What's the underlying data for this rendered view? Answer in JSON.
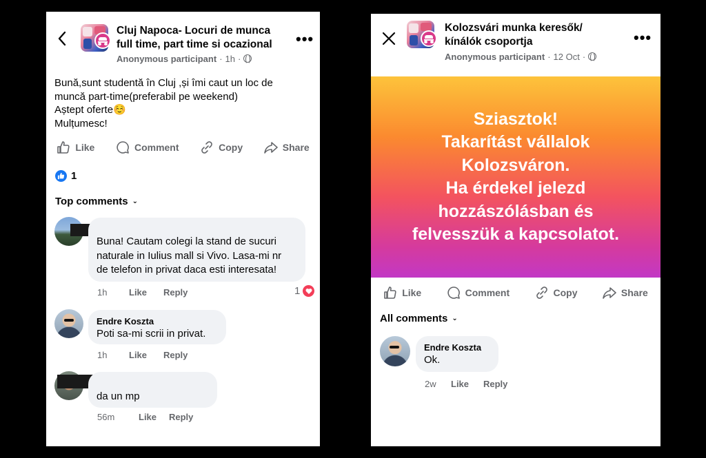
{
  "left": {
    "group_title_line1": "Cluj Napoca- Locuri de munca",
    "group_title_line2": "full time, part time si ocazional",
    "author": "Anonymous participant",
    "time": "1h",
    "back_icon": "chevron-left-icon",
    "more_icon": "more-icon",
    "post_lines": [
      "Bună,sunt studentă în Cluj ,și îmi caut un loc de",
      "muncă part-time(preferabil pe weekend)",
      "Aștept oferte☺️",
      "Mulțumesc!"
    ],
    "actions": {
      "like": "Like",
      "comment": "Comment",
      "copy": "Copy",
      "share": "Share"
    },
    "reaction_count": "1",
    "comments_title": "Top comments",
    "comments": [
      {
        "author": "",
        "lines": [
          "Buna! Cautam colegi la stand de sucuri",
          "naturale in Iulius mall si Vivo. Lasa-mi nr",
          "de telefon in privat daca esti interesata!"
        ],
        "time": "1h",
        "like": "Like",
        "reply": "Reply",
        "reaction_count": "1"
      },
      {
        "author": "Endre Koszta",
        "lines": [
          "Poti sa-mi scrii in privat."
        ],
        "time": "1h",
        "like": "Like",
        "reply": "Reply"
      },
      {
        "author": "",
        "lines": [
          "da un mp"
        ],
        "time": "56m",
        "like": "Like",
        "reply": "Reply"
      }
    ]
  },
  "right": {
    "group_title_line1": "Kolozsvári munka keresők/",
    "group_title_line2": "kínálók csoportja",
    "author": "Anonymous participant",
    "time": "12 Oct",
    "close_icon": "close-icon",
    "banner_lines": [
      "Sziasztok!",
      "Takarítást vállalok",
      "Kolozsváron.",
      "Ha érdekel jelezd",
      "hozzászólásban és",
      "felvesszük a kapcsolatot."
    ],
    "actions": {
      "like": "Like",
      "comment": "Comment",
      "copy": "Copy",
      "share": "Share"
    },
    "comments_title": "All comments",
    "comments": [
      {
        "author": "Endre Koszta",
        "lines": [
          "Ok."
        ],
        "time": "2w",
        "like": "Like",
        "reply": "Reply"
      }
    ]
  },
  "colors": {
    "accent_blue": "#1877f2",
    "heart_red": "#f33e58",
    "meta_gray": "#65676b",
    "bubble_bg": "#f0f2f5"
  }
}
